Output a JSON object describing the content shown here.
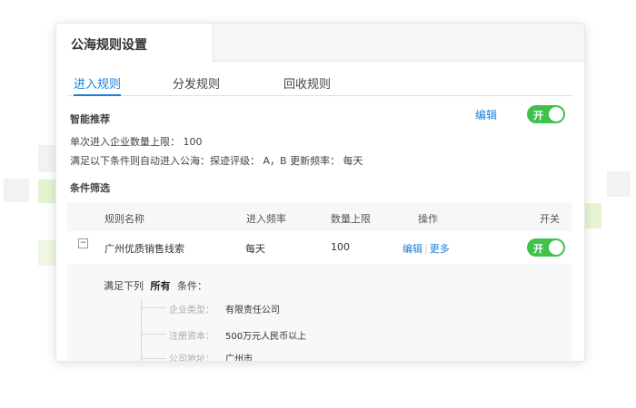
{
  "colors": {
    "accent": "#1a7fd9",
    "switch_on": "#3fc14c",
    "deco_green": "#e6f4d4",
    "deco_gray": "#f1f1f1"
  },
  "window": {
    "title": "公海规则设置"
  },
  "tabs": [
    {
      "label": "进入规则",
      "active": true
    },
    {
      "label": "分发规则",
      "active": false
    },
    {
      "label": "回收规则",
      "active": false
    }
  ],
  "smart": {
    "heading": "智能推荐",
    "edit_label": "编辑",
    "switch_label": "开",
    "limit_text": "单次进入企业数量上限： 100",
    "condition_text": "满足以下条件则自动进入公海：探迹评级： A，B    更新频率： 每天"
  },
  "filter": {
    "heading": "条件筛选",
    "columns": [
      "规则名称",
      "进入频率",
      "数量上限",
      "操作",
      "开关"
    ],
    "rows": [
      {
        "expand_symbol": "−",
        "name": "广州优质销售线索",
        "frequency": "每天",
        "limit": "100",
        "action_edit": "编辑",
        "action_more": "更多",
        "switch_label": "开"
      }
    ],
    "detail": {
      "prefix": "满足下列",
      "emphasis": "所有",
      "suffix": "条件：",
      "conditions": [
        {
          "key": "企业类型：",
          "value": "有限责任公司"
        },
        {
          "key": "注册资本：",
          "value": "500万元人民币以上"
        },
        {
          "key": "公司地址：",
          "value": "广州市"
        }
      ]
    }
  }
}
